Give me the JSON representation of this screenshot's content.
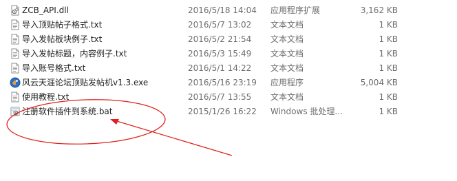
{
  "files": [
    {
      "name": "ZCB_API.dll",
      "date": "2016/5/18 14:04",
      "type": "应用程序扩展",
      "size": "3,162 KB",
      "icon": "dll-file-icon"
    },
    {
      "name": "导入顶贴帖子格式.txt",
      "date": "2016/5/7 13:02",
      "type": "文本文档",
      "size": "1 KB",
      "icon": "text-file-icon"
    },
    {
      "name": "导入发帖板块例子.txt",
      "date": "2016/5/2 21:54",
      "type": "文本文档",
      "size": "1 KB",
      "icon": "text-file-icon"
    },
    {
      "name": "导入发帖标题，内容例子.txt",
      "date": "2016/5/3 15:49",
      "type": "文本文档",
      "size": "1 KB",
      "icon": "text-file-icon"
    },
    {
      "name": "导入账号格式.txt",
      "date": "2016/5/1 14:22",
      "type": "文本文档",
      "size": "1 KB",
      "icon": "text-file-icon"
    },
    {
      "name": "风云天涯论坛顶贴发帖机v1.3.exe",
      "date": "2016/5/16 23:19",
      "type": "应用程序",
      "size": "5,004 KB",
      "icon": "exe-app-icon"
    },
    {
      "name": "使用教程.txt",
      "date": "2016/5/7 13:55",
      "type": "文本文档",
      "size": "1 KB",
      "icon": "text-file-icon"
    },
    {
      "name": "注册软件插件到系统.bat",
      "date": "2015/1/26 16:22",
      "type": "Windows 批处理...",
      "size": "1 KB",
      "icon": "batch-file-icon"
    }
  ],
  "colors": {
    "annotation": "#e0231a",
    "detail_text": "#6d6d6d",
    "name_text": "#1e1e1e"
  }
}
